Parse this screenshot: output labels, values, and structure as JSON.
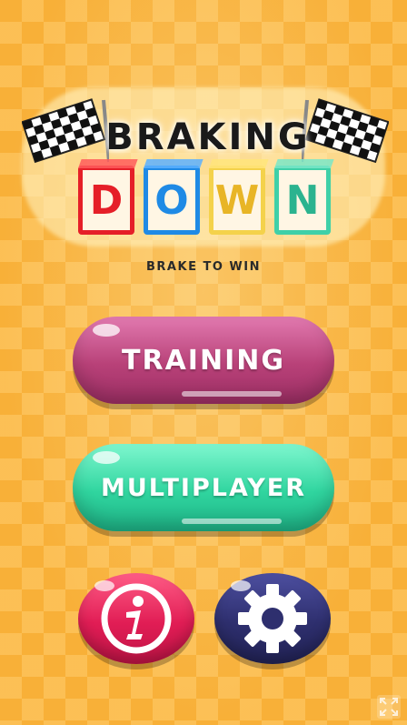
{
  "logo": {
    "title_top": "BRAKING",
    "letters": [
      "D",
      "O",
      "W",
      "N"
    ],
    "tagline": "BRAKE TO WIN"
  },
  "menu": {
    "training_label": "TRAINING",
    "multiplayer_label": "MULTIPLAYER"
  },
  "icons": {
    "info": "info-icon",
    "settings": "gear-icon",
    "fullscreen": "fullscreen-icon",
    "flags": "checkered-flag-icon"
  },
  "colors": {
    "background": "#f7b13b",
    "training": "#b84178",
    "multiplayer": "#30d59f",
    "info": "#e11d55",
    "settings": "#2e2f6e",
    "letter_d": "#e51f28",
    "letter_o": "#1f8ae5",
    "letter_w": "#f4d24b",
    "letter_n": "#3fd0a8"
  }
}
